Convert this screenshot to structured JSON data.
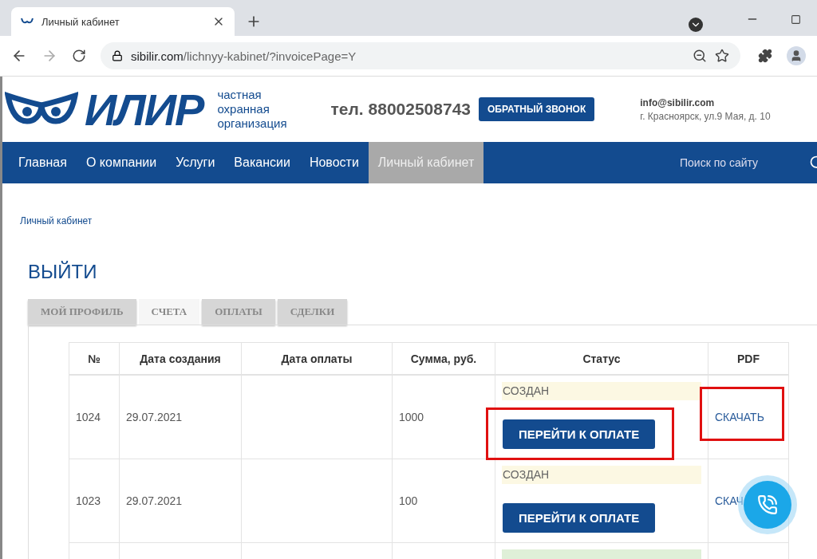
{
  "browser": {
    "tab_title": "Личный кабинет",
    "url_host": "sibilir.com",
    "url_path": "/lichnyy-kabinet/?invoicePage=Y"
  },
  "header": {
    "logo_text": "ИЛИР",
    "tagline": [
      "частная",
      "охранная",
      "организация"
    ],
    "phone": "тел. 88002508743",
    "callback_button": "ОБРАТНЫЙ ЗВОНОК",
    "email": "info@sibilir.com",
    "address": "г. Красноярск, ул.9 Мая, д. 10"
  },
  "nav": {
    "items": [
      {
        "label": "Главная",
        "selected": false
      },
      {
        "label": "О компании",
        "selected": false
      },
      {
        "label": "Услуги",
        "selected": false
      },
      {
        "label": "Вакансии",
        "selected": false
      },
      {
        "label": "Новости",
        "selected": false
      },
      {
        "label": "Личный кабинет",
        "selected": true
      }
    ],
    "search_placeholder": "Поиск по сайту"
  },
  "breadcrumb": "Личный кабинет",
  "logout": "ВЫЙТИ",
  "tabs": [
    {
      "label": "МОЙ ПРОФИЛЬ",
      "selected": false
    },
    {
      "label": "СЧЕТА",
      "selected": true
    },
    {
      "label": "ОПЛАТЫ",
      "selected": false
    },
    {
      "label": "СДЕЛКИ",
      "selected": false
    }
  ],
  "table": {
    "columns": [
      "№",
      "Дата создания",
      "Дата оплаты",
      "Сумма, руб.",
      "Статус",
      "PDF"
    ],
    "rows": [
      {
        "number": "1024",
        "created": "29.07.2021",
        "amount": "1000",
        "status": {
          "kind": "created",
          "label": "СОЗДАН"
        },
        "pay_button": "ПЕРЕЙТИ К ОПЛАТЕ",
        "pdf": "СКАЧАТЬ",
        "highlighted": true
      },
      {
        "number": "1023",
        "created": "29.07.2021",
        "amount": "100",
        "status": {
          "kind": "created",
          "label": "СОЗДАН"
        },
        "pay_button": "ПЕРЕЙТИ К ОПЛАТЕ",
        "pdf": "СКАЧ",
        "highlighted": false
      },
      {
        "status": {
          "kind": "paid"
        },
        "highlighted": false
      }
    ]
  }
}
